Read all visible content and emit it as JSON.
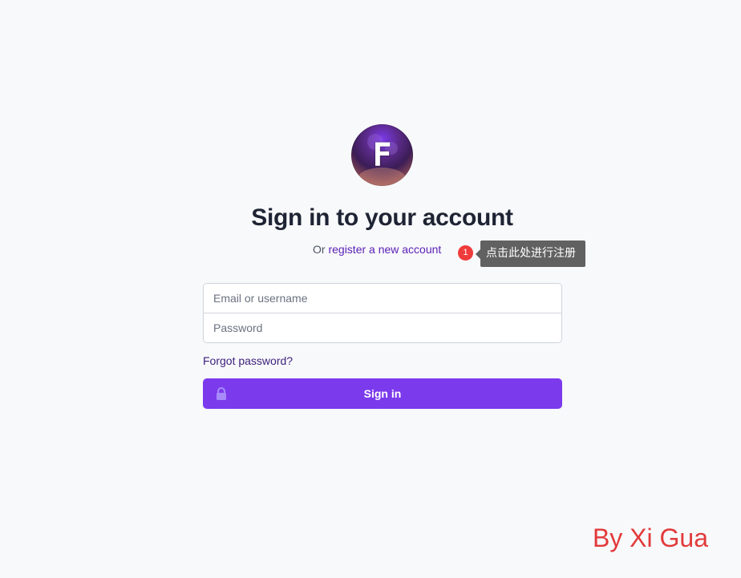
{
  "logo": {
    "letter": "F",
    "icon": "app-logo-icon"
  },
  "heading": {
    "title": "Sign in to your account",
    "or_text": "Or",
    "register_link": "register a new account"
  },
  "annotation": {
    "badge_number": "1",
    "tooltip_text": "点击此处进行注册"
  },
  "form": {
    "email_placeholder": "Email or username",
    "password_placeholder": "Password",
    "forgot_link": "Forgot password?",
    "submit_label": "Sign in",
    "submit_icon": "lock-icon"
  },
  "watermark": {
    "text": "By Xi Gua"
  },
  "colors": {
    "background": "#f8f9fb",
    "primary": "#7c3aed",
    "link": "#5b21b6",
    "badge": "#ef3b3b",
    "tooltip": "#616161",
    "watermark": "#e23a3a"
  }
}
